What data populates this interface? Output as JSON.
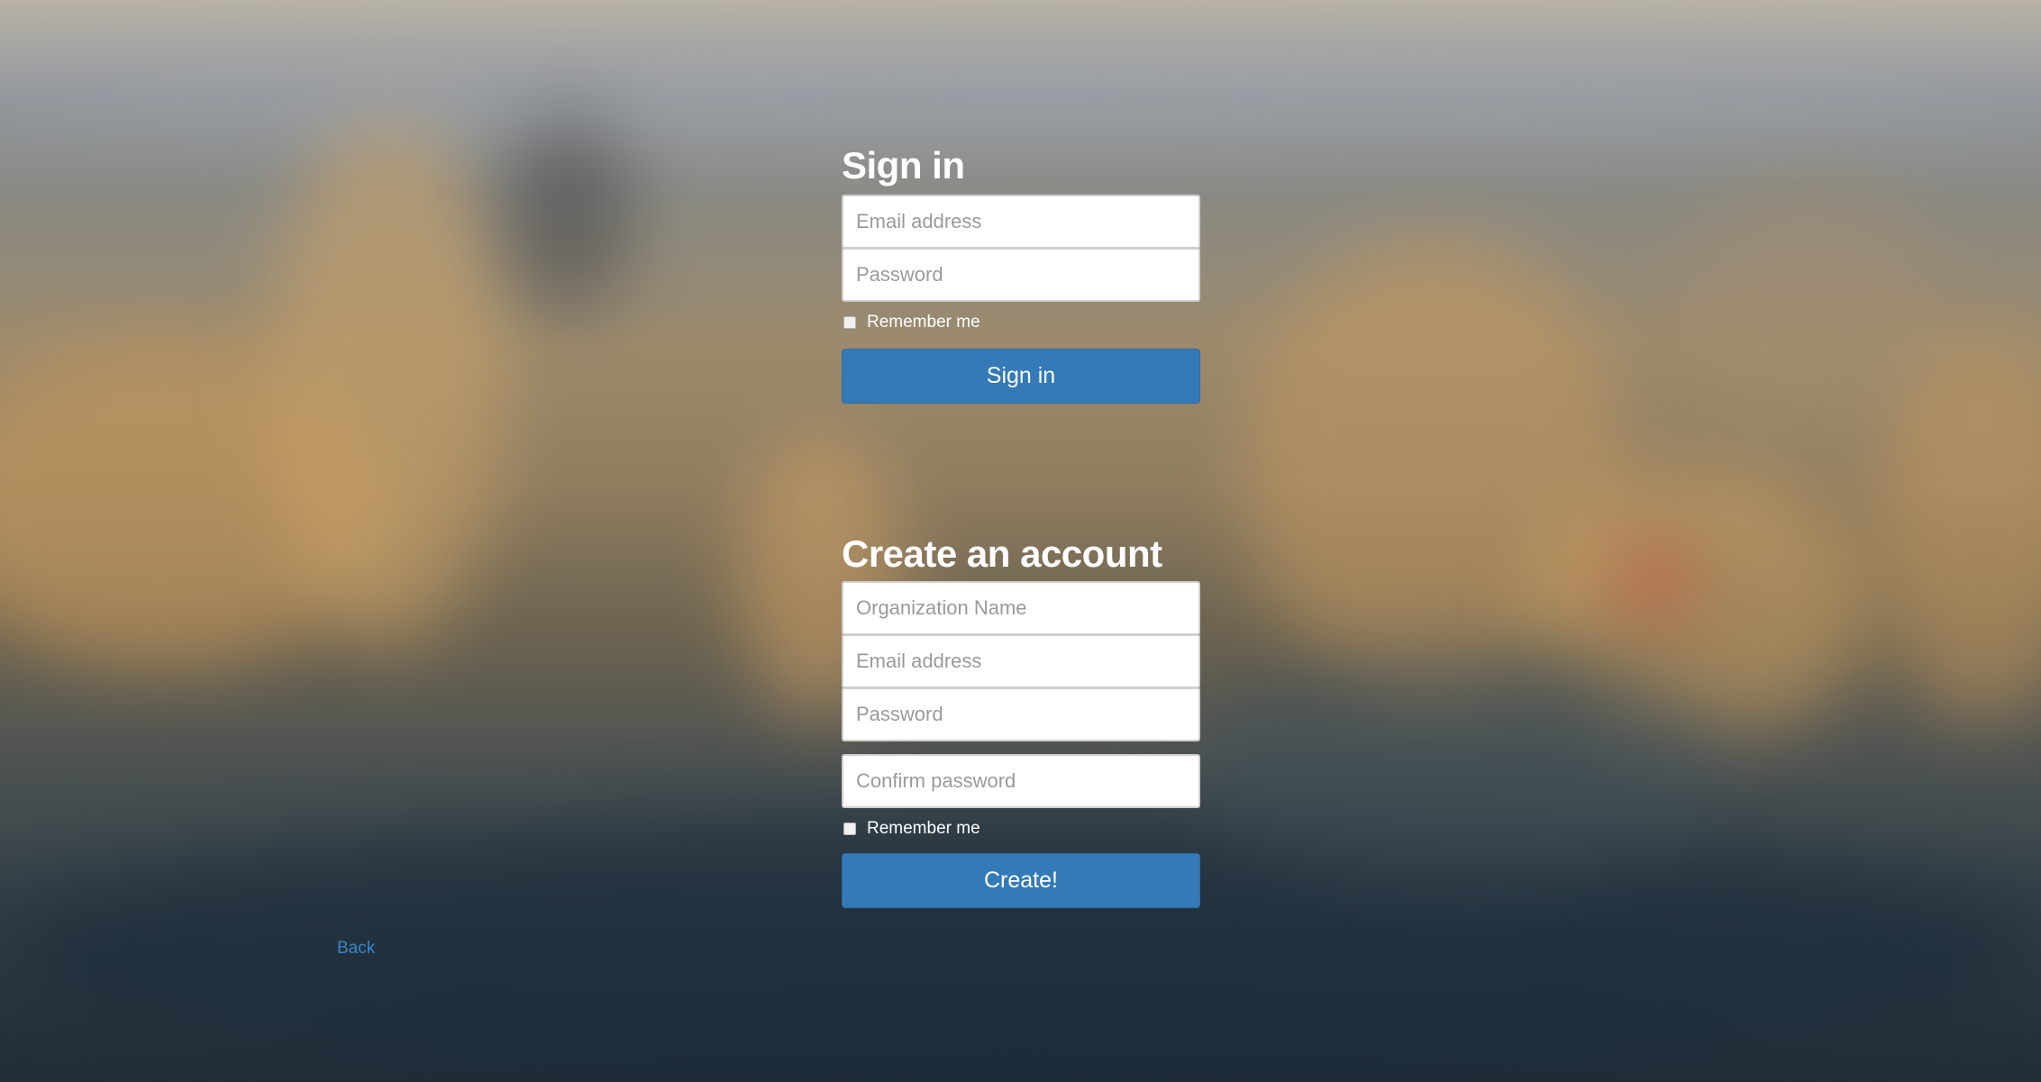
{
  "signin": {
    "title": "Sign in",
    "email_placeholder": "Email address",
    "password_placeholder": "Password",
    "remember_label": "Remember me",
    "submit_label": "Sign in"
  },
  "create": {
    "title": "Create an account",
    "org_placeholder": "Organization Name",
    "email_placeholder": "Email address",
    "password_placeholder": "Password",
    "confirm_placeholder": "Confirm password",
    "remember_label": "Remember me",
    "submit_label": "Create!"
  },
  "nav": {
    "back_label": "Back"
  },
  "colors": {
    "primary_button": "#337ab7",
    "link": "#3a84c4"
  }
}
